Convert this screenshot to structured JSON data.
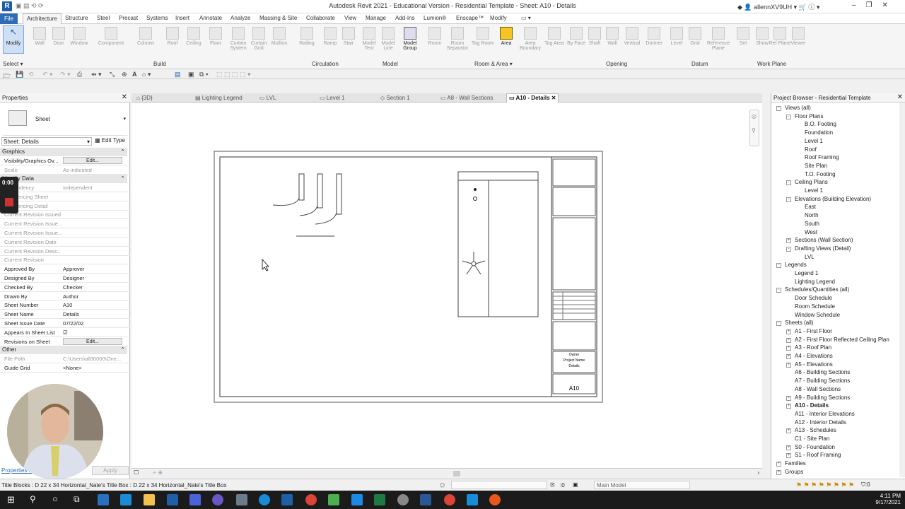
{
  "app": {
    "title": "Autodesk Revit 2021 - Educational Version - Residential Template - Sheet: A10 - Details",
    "logo": "R",
    "user": "allennXV9UH",
    "window_buttons": [
      "–",
      "❐",
      "✕"
    ]
  },
  "ribbon_tabs": [
    "File",
    "Architecture",
    "Structure",
    "Steel",
    "Precast",
    "Systems",
    "Insert",
    "Annotate",
    "Analyze",
    "Massing & Site",
    "Collaborate",
    "View",
    "Manage",
    "Add-Ins",
    "Lumion®",
    "Enscape™",
    "Modify"
  ],
  "ribbon_buttons": [
    "Modify",
    "Wall",
    "Door",
    "Window",
    "Component",
    "Column",
    "Roof",
    "Ceiling",
    "Floor",
    "Curtain System",
    "Curtain Grid",
    "Mullion",
    "Railing",
    "Ramp",
    "Stair",
    "Model Text",
    "Model Line",
    "Model Group",
    "Room",
    "Room Separator",
    "Tag Room",
    "Area",
    "Area Boundary",
    "Tag Area",
    "By Face",
    "Shaft",
    "Wall",
    "Vertical",
    "Dormer",
    "Level",
    "Grid",
    "Reference Plane",
    "Set",
    "Show",
    "Ref Plane",
    "Viewer"
  ],
  "ribbon_panels": [
    "Select ▾",
    "Build",
    "Circulation",
    "Model",
    "Room & Area ▾",
    "Opening",
    "Datum",
    "Work Plane"
  ],
  "properties": {
    "title": "Properties",
    "type_name": "Sheet",
    "selector": "Sheet: Details",
    "edit_type": "Edit Type",
    "sections": {
      "graphics": "Graphics",
      "identity": "Identity Data",
      "other": "Other"
    },
    "graphics_rows": [
      {
        "k": "Visibility/Graphics Ov...",
        "v": "Edit..."
      },
      {
        "k": "Scale",
        "v": "As indicated"
      }
    ],
    "identity_rows": [
      {
        "k": "Dependency",
        "v": "Independent"
      },
      {
        "k": "Referencing Sheet",
        "v": ""
      },
      {
        "k": "Referencing Detail",
        "v": ""
      },
      {
        "k": "Current Revision Issued",
        "v": ""
      },
      {
        "k": "Current Revision Issue...",
        "v": ""
      },
      {
        "k": "Current Revision Issue...",
        "v": ""
      },
      {
        "k": "Current Revision Date",
        "v": ""
      },
      {
        "k": "Current Revision Desc...",
        "v": ""
      },
      {
        "k": "Current Revision",
        "v": ""
      },
      {
        "k": "Approved By",
        "v": "Approver"
      },
      {
        "k": "Designed By",
        "v": "Designer"
      },
      {
        "k": "Checked By",
        "v": "Checker"
      },
      {
        "k": "Drawn By",
        "v": "Author"
      },
      {
        "k": "Sheet Number",
        "v": "A10"
      },
      {
        "k": "Sheet Name",
        "v": "Details"
      },
      {
        "k": "Sheet Issue Date",
        "v": "07/22/02"
      },
      {
        "k": "Appears In Sheet List",
        "v": "☑"
      },
      {
        "k": "Revisions on Sheet",
        "v": "Edit..."
      }
    ],
    "other_rows": [
      {
        "k": "File Path",
        "v": "C:\\Users\\all30000\\One..."
      },
      {
        "k": "Guide Grid",
        "v": "<None>"
      }
    ],
    "help_link": "Properties help",
    "apply": "Apply",
    "timer": "0:00"
  },
  "view_tabs": [
    "{3D}",
    "Lighting Legend",
    "LVL",
    "Level 1",
    "Section 1",
    "A8 - Wall Sections",
    "A10 - Details"
  ],
  "sheet": {
    "number": "A10",
    "title_lines": [
      "Owner",
      "Project Name",
      "Details"
    ]
  },
  "project_browser": {
    "title": "Project Browser - Residential Template",
    "nodes": [
      {
        "t": "Views (all)",
        "l": 0,
        "e": "-"
      },
      {
        "t": "Floor Plans",
        "l": 1,
        "e": "-"
      },
      {
        "t": "B.O. Footing",
        "l": 2
      },
      {
        "t": "Foundation",
        "l": 2
      },
      {
        "t": "Level 1",
        "l": 2
      },
      {
        "t": "Roof",
        "l": 2
      },
      {
        "t": "Roof Framing",
        "l": 2
      },
      {
        "t": "Site Plan",
        "l": 2
      },
      {
        "t": "T.O. Footing",
        "l": 2
      },
      {
        "t": "Ceiling Plans",
        "l": 1,
        "e": "-"
      },
      {
        "t": "Level 1",
        "l": 2
      },
      {
        "t": "Elevations (Building Elevation)",
        "l": 1,
        "e": "-"
      },
      {
        "t": "East",
        "l": 2
      },
      {
        "t": "North",
        "l": 2
      },
      {
        "t": "South",
        "l": 2
      },
      {
        "t": "West",
        "l": 2
      },
      {
        "t": "Sections (Wall Section)",
        "l": 1,
        "e": "+"
      },
      {
        "t": "Drafting Views (Detail)",
        "l": 1,
        "e": "-"
      },
      {
        "t": "LVL",
        "l": 2
      },
      {
        "t": "Legends",
        "l": 0,
        "e": "-"
      },
      {
        "t": "Legend 1",
        "l": 1
      },
      {
        "t": "Lighting Legend",
        "l": 1
      },
      {
        "t": "Schedules/Quantities (all)",
        "l": 0,
        "e": "-"
      },
      {
        "t": "Door Schedule",
        "l": 1
      },
      {
        "t": "Room Schedule",
        "l": 1
      },
      {
        "t": "Window Schedule",
        "l": 1
      },
      {
        "t": "Sheets (all)",
        "l": 0,
        "e": "-"
      },
      {
        "t": "A1 - First Floor",
        "l": 1,
        "e": "+"
      },
      {
        "t": "A2 - First Floor Reflected Ceiling Plan",
        "l": 1,
        "e": "+"
      },
      {
        "t": "A3 - Roof Plan",
        "l": 1,
        "e": "+"
      },
      {
        "t": "A4 - Elevations",
        "l": 1,
        "e": "+"
      },
      {
        "t": "A5 - Elevations",
        "l": 1,
        "e": "+"
      },
      {
        "t": "A6 - Building Sections",
        "l": 1
      },
      {
        "t": "A7 - Building Sections",
        "l": 1
      },
      {
        "t": "A8 - Wall Sections",
        "l": 1
      },
      {
        "t": "A9 - Building Sections",
        "l": 1,
        "e": "+"
      },
      {
        "t": "A10 - Details",
        "l": 1,
        "e": "+",
        "b": true
      },
      {
        "t": "A11 - Interior Elevations",
        "l": 1
      },
      {
        "t": "A12 - Interior Details",
        "l": 1
      },
      {
        "t": "A13 - Schedules",
        "l": 1,
        "e": "+"
      },
      {
        "t": "C1 - Site Plan",
        "l": 1
      },
      {
        "t": "S0 - Foundation",
        "l": 1,
        "e": "+"
      },
      {
        "t": "S1 - Roof Framing",
        "l": 1,
        "e": "+"
      },
      {
        "t": "Families",
        "l": 0,
        "e": "+"
      },
      {
        "t": "Groups",
        "l": 0,
        "e": "+"
      }
    ]
  },
  "status": {
    "text": "Title Blocks : D 22 x 34 Horizontal_Nate's Title Box : D 22 x 34 Horizontal_Nate's Title Box",
    "coord": ":0",
    "model": "Main Model"
  },
  "clock": {
    "time": "4:11 PM",
    "date": "9/17/2021"
  }
}
